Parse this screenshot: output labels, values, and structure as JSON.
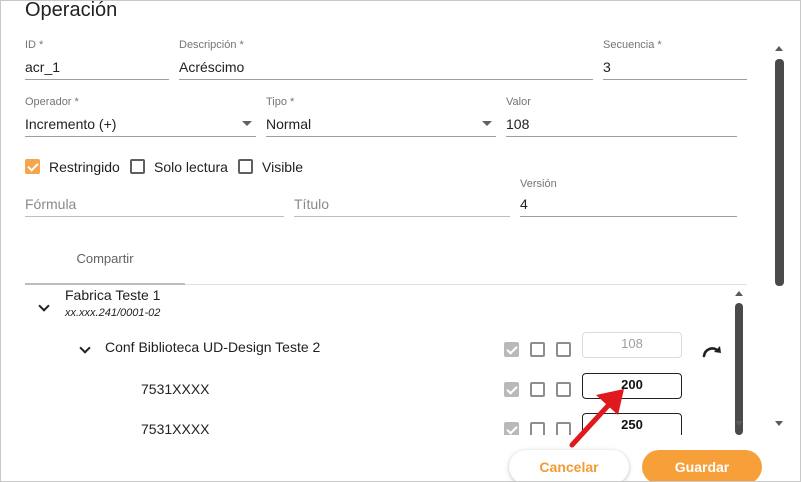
{
  "dialog": {
    "title": "Operación"
  },
  "fields": {
    "id": {
      "label": "ID *",
      "value": "acr_1"
    },
    "descripcion": {
      "label": "Descripción *",
      "value": "Acréscimo"
    },
    "secuencia": {
      "label": "Secuencia *",
      "value": "3"
    },
    "operador": {
      "label": "Operador *",
      "value": "Incremento (+)"
    },
    "tipo": {
      "label": "Tipo *",
      "value": "Normal"
    },
    "valor": {
      "label": "Valor",
      "value": "108"
    },
    "formula": {
      "placeholder": "Fórmula"
    },
    "titulo": {
      "placeholder": "Título"
    },
    "version": {
      "label": "Versión",
      "value": "4"
    }
  },
  "checkboxes": {
    "restringido": {
      "label": "Restringido",
      "checked": true
    },
    "solo_lectura": {
      "label": "Solo lectura",
      "checked": false
    },
    "visible": {
      "label": "Visible",
      "checked": false
    }
  },
  "tabs": [
    {
      "label": "Compartir"
    }
  ],
  "tree": {
    "company": {
      "name": "Fabrica Teste 1",
      "subtitle": "xx.xxx.241/0001-02"
    },
    "config": {
      "name": "Conf Biblioteca UD-Design Teste 2",
      "value": "108"
    },
    "items": [
      {
        "code": "7531XXXX",
        "value": "200"
      },
      {
        "code": "7531XXXX",
        "value": "250"
      }
    ]
  },
  "buttons": {
    "cancel": "Cancelar",
    "save": "Guardar"
  },
  "colors": {
    "accent": "#f7a03a",
    "annotation_arrow": "#e0191f"
  }
}
